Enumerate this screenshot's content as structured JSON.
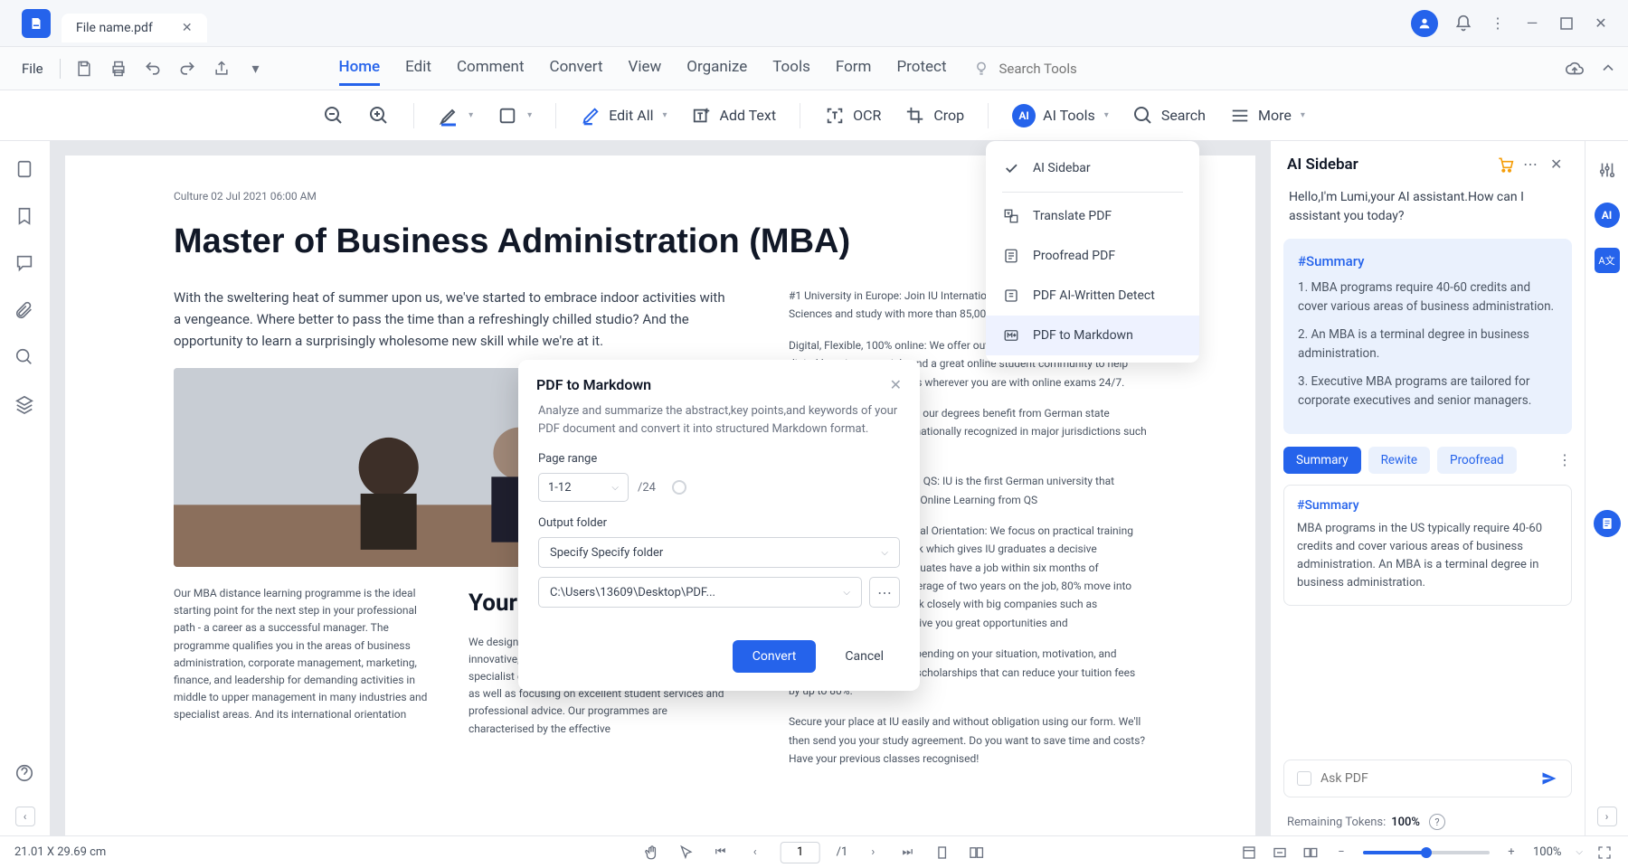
{
  "titlebar": {
    "tab_name": "File name.pdf"
  },
  "menubar": {
    "file": "File",
    "tabs": [
      "Home",
      "Edit",
      "Comment",
      "Convert",
      "View",
      "Organize",
      "Tools",
      "Form",
      "Protect"
    ],
    "search_placeholder": "Search Tools"
  },
  "toolbar": {
    "edit_all": "Edit All",
    "add_text": "Add Text",
    "ocr": "OCR",
    "crop": "Crop",
    "ai_tools": "AI Tools",
    "search": "Search",
    "more": "More"
  },
  "dropdown": {
    "items": [
      "AI Sidebar",
      "Translate PDF",
      "Proofread PDF",
      "PDF AI-Written Detect",
      "PDF to Markdown"
    ]
  },
  "dialog": {
    "title": "PDF to Markdown",
    "desc": "Analyze and summarize the abstract,key points,and keywords of your PDF document and convert it into structured Markdown format.",
    "page_range_label": "Page range",
    "page_range_value": "1-12",
    "page_total": "/24",
    "output_folder_label": "Output folder",
    "output_folder_select": "Specify Specify folder",
    "output_path": "C:\\Users\\13609\\Desktop\\PDF...",
    "convert": "Convert",
    "cancel": "Cancel"
  },
  "ai_sidebar": {
    "title": "AI Sidebar",
    "greeting": "Hello,I'm Lumi,your AI assistant.How can I assistant you today?",
    "summary_title": "#Summary",
    "summary_points": [
      "1. MBA programs require 40-60 credits and cover various areas of business administration.",
      "2. An MBA is a terminal degree in business administration.",
      "3. Executive MBA programs are tailored for corporate executives and senior managers."
    ],
    "chips": [
      "Summary",
      "Rewite",
      "Proofread"
    ],
    "result_title": "#Summary",
    "result_text": "MBA programs in the US typically require 40-60 credits and cover various areas of business administration. An MBA is a terminal degree in business administration.",
    "ask_placeholder": "Ask PDF",
    "tokens_label": "Remaining Tokens:",
    "tokens_value": "100%"
  },
  "document": {
    "meta": "Culture 02 Jul 2021 06:00 AM",
    "title": "Master of Business Administration (MBA)",
    "intro": "With the sweltering heat of summer upon us, we've started to embrace indoor activities with a vengeance. Where better to pass the time than a refreshingly chilled studio? And the opportunity to learn a surprisingly wholesome new skill while we're at it.",
    "lower_left": "Our MBA distance learning programme is the ideal starting point for the next step in your professional path - a career as a successful manager. The programme qualifies you in the areas of business administration, corporate management, marketing, finance, and leadership for demanding activities in middle to upper management in many industries and specialist areas. And its international orientation",
    "lower_head": "Your de",
    "lower_right": "We design our programmes to be flexible and innovative, while maintaining strong quality. We deliver specialist expertise and innovative learning materials as well as focusing on excellent student services and professional advice. Our programmes are characterised by the effective",
    "right_paras": [
      "#1 University in Europe: Join IU International University of Applied Sciences and study with more than 85,000 students",
      "Digital, Flexible, 100% online: We offer outstanding, interactive innovative digital learning materials and a great online student community to help you succeed in your studies wherever you are with online exams 24/7.",
      "Fully Accredited Degree: All our degrees benefit from German state accreditation and are internationally recognized in major jurisdictions such as the EU, US and",
      "5-Star rated University from QS: IU is the first German university that achieved a 5-star rating for Online Learning from QS",
      "International Focus, Practical Orientation: We focus on practical training and an international outlook which gives IU graduates a decisive advantage: 94% of our graduates have a job within six months of graduation and, after an average of two years on the job, 80% move into management. Plus, we work closely with big companies such as Lufthansa, Sixt, and EY to give you great opportunities and",
      "Scholarships Available: Depending on your situation, motivation, and background, we also offer scholarships that can reduce your tuition fees by up to 80%.",
      "Secure your place at IU easily and without obligation using our form. We'll then send you your study agreement. Do you want to save time and costs? Have your previous classes recognised!"
    ]
  },
  "statusbar": {
    "dimensions": "21.01 X 29.69 cm",
    "page_current": "1",
    "page_total": "/1",
    "zoom": "100%"
  }
}
